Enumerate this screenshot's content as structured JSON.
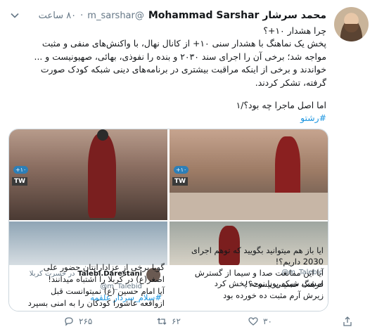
{
  "tweet": {
    "author_name": "محمد سرشار Mohammad Sarshar",
    "handle": "@m_sarshar",
    "dot": "·",
    "time": "۸۰ ساعت",
    "lines": [
      "چرا هشدار ۱۰+؟",
      "پخش یک نماهنگ با هشدار سنی ۱۰+ از کانال نهال، با واکنش‌های منفی و مثبت",
      "مواجه شد؛ برخی آن را اجرای سند ۲۰۳۰ و بنده را نفوذی، بهائی، صهیونیست و ...",
      "خواندند و برخی از اینکه مراقبت بیشتری در برنامه‌های دینی شبکه کودک صورت",
      "گرفته، تشکر کردند."
    ],
    "question": "اما اصل ماجرا چه بود؟/۱",
    "hashtag": "#رشتو"
  },
  "media": {
    "age_tag": "+۱۰",
    "channel_logo": "TW",
    "quote_left": {
      "name": "Talebi.Darestani",
      "handle": "@m_Talebid",
      "date": "در حسرت کربلا",
      "lines": [
        "#سلام_سردار علقمه",
        "گویا برخی از عزادارانتان حضور علی",
        "اصغر(ع) در کربلا را اشتباه میدانند!",
        "آیا امام حسین (ع) نمیتوانست قبل",
        "ازواقعه عاشورا کودکان را به امنی بسپرد"
      ]
    },
    "quote_right": {
      "handle": "@m_Talebid",
      "lines": [
        "امشب شبکه پویا نوحه پخش کرد",
        "زیرش آرم مثبت ده خورده بود",
        "ایا باز هم میتوانید بگویید که توهم اجرای",
        "2030 داریم؟!",
        "آیا این ممانعت صدا و سیما از گسترش",
        "فرهنگ حسینی نیست؟!"
      ]
    }
  },
  "actions": {
    "reply_count": "۲۶۵",
    "retweet_count": "۶۲",
    "like_count": "۳۰"
  },
  "colors": {
    "link": "#1b95e0",
    "muted": "#657786",
    "border": "#ccd6dd"
  }
}
